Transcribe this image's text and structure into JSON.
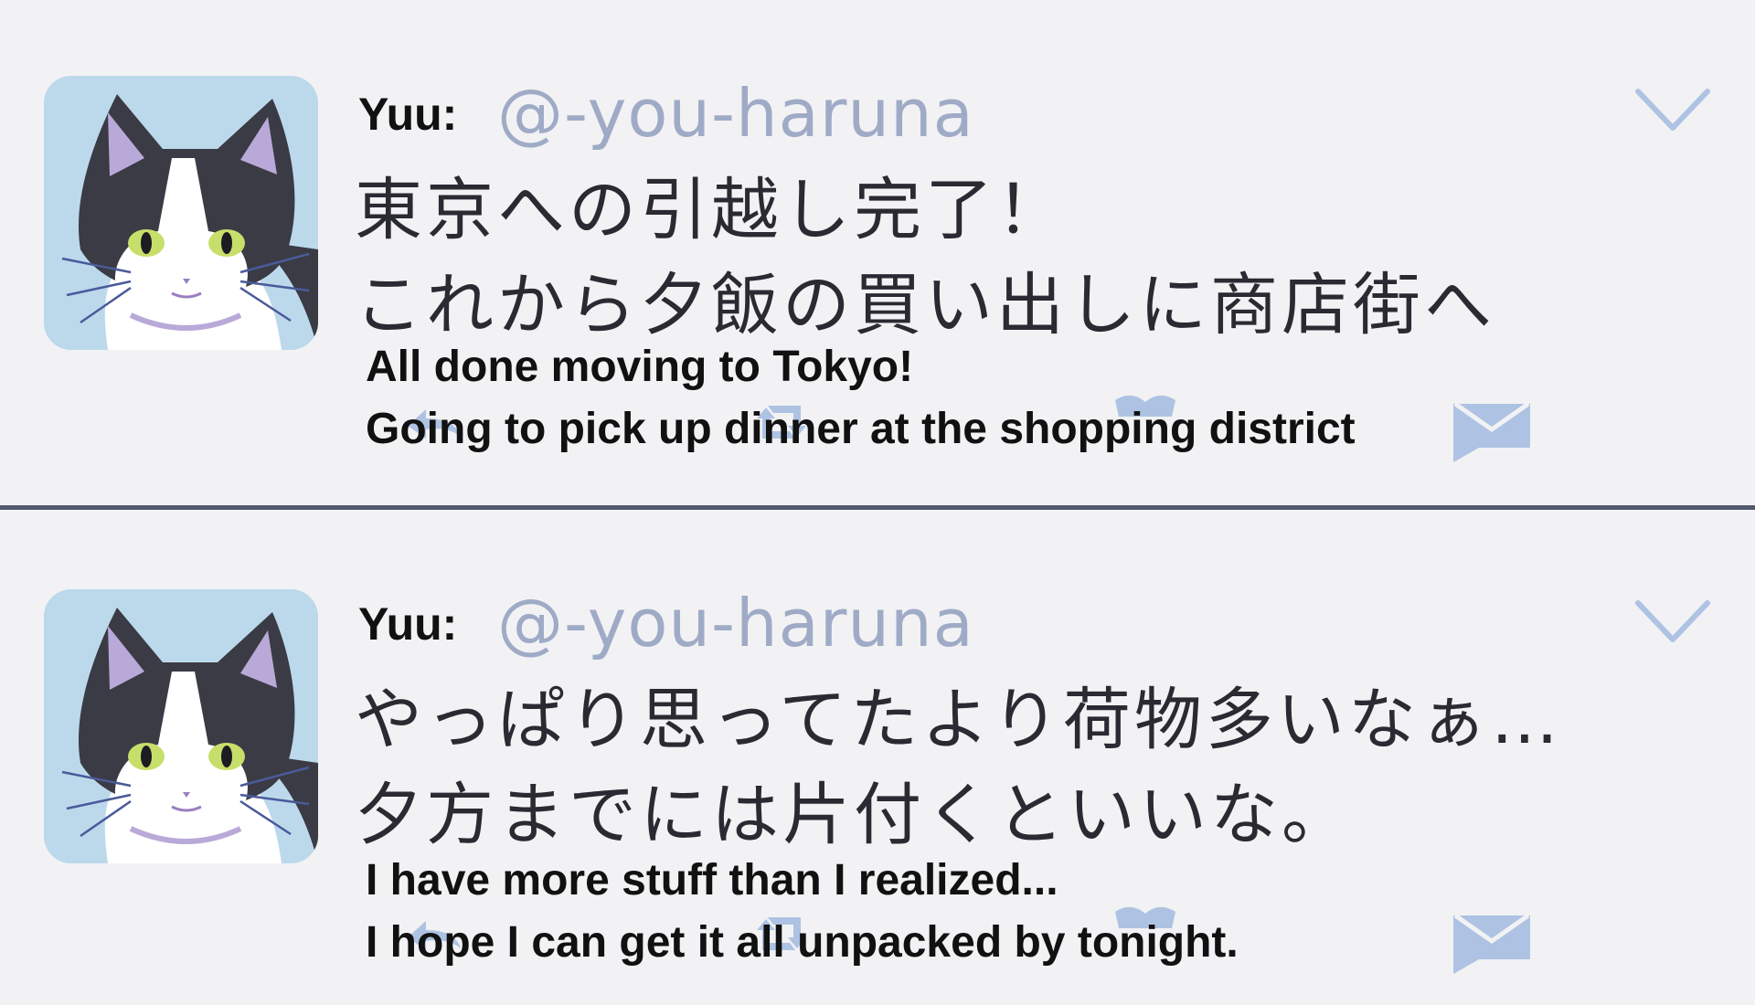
{
  "colors": {
    "background": "#f2f2f4",
    "handle": "#9fabc6",
    "icon_blue": "#aec3e3",
    "divider": "#55596e",
    "avatar_bg": "#bcd9ec"
  },
  "posts": [
    {
      "display_name": "Yuu:",
      "handle": "@-you-haruna",
      "avatar_icon": "cat-avatar-icon",
      "menu_icon": "chevron-down-icon",
      "text_jp": [
        "東京への引越し完了！",
        "これから夕飯の買い出しに商店街へ"
      ],
      "subtitle": [
        "All done moving to Tokyo!",
        "Going to pick up dinner at the shopping district"
      ],
      "actions": [
        "reply-icon",
        "retweet-icon",
        "like-icon",
        "mail-icon"
      ]
    },
    {
      "display_name": "Yuu:",
      "handle": "@-you-haruna",
      "avatar_icon": "cat-avatar-icon",
      "menu_icon": "chevron-down-icon",
      "text_jp": [
        "やっぱり思ってたより荷物多いなぁ…",
        "夕方までには片付くといいな。"
      ],
      "subtitle": [
        "I have more stuff than I realized...",
        "I hope I can get it all unpacked by tonight."
      ],
      "actions": [
        "reply-icon",
        "retweet-icon",
        "like-icon",
        "mail-icon"
      ]
    }
  ]
}
